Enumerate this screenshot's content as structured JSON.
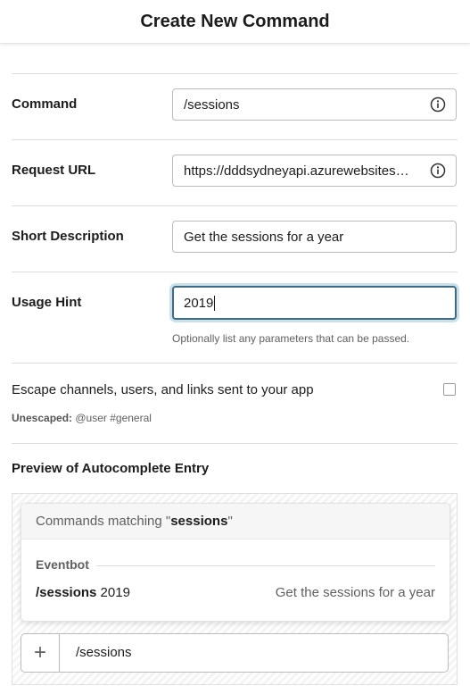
{
  "header": {
    "title": "Create New Command"
  },
  "form": {
    "command": {
      "label": "Command",
      "value": "/sessions",
      "icon": "info-icon"
    },
    "request_url": {
      "label": "Request URL",
      "value": "https://dddsydneyapi.azurewebsites…",
      "icon": "info-icon"
    },
    "short_description": {
      "label": "Short Description",
      "value": "Get the sessions for a year"
    },
    "usage_hint": {
      "label": "Usage Hint",
      "value": "2019",
      "hint": "Optionally list any parameters that can be passed."
    },
    "escape": {
      "label": "Escape channels, users, and links sent to your app",
      "checked": false,
      "unescaped_label": "Unescaped:",
      "unescaped_example": "@user #general"
    }
  },
  "preview": {
    "title": "Preview of Autocomplete Entry",
    "header_prefix": "Commands matching \"",
    "header_term": "sessions",
    "header_suffix": "\"",
    "app_name": "Eventbot",
    "command_name": "/sessions",
    "command_hint": "2019",
    "command_description": "Get the sessions for a year",
    "composer_plus": "+",
    "composer_text": "/sessions"
  },
  "colors": {
    "focus_border": "#3d6b84",
    "divider": "#dddddd",
    "muted_text": "#616061"
  }
}
